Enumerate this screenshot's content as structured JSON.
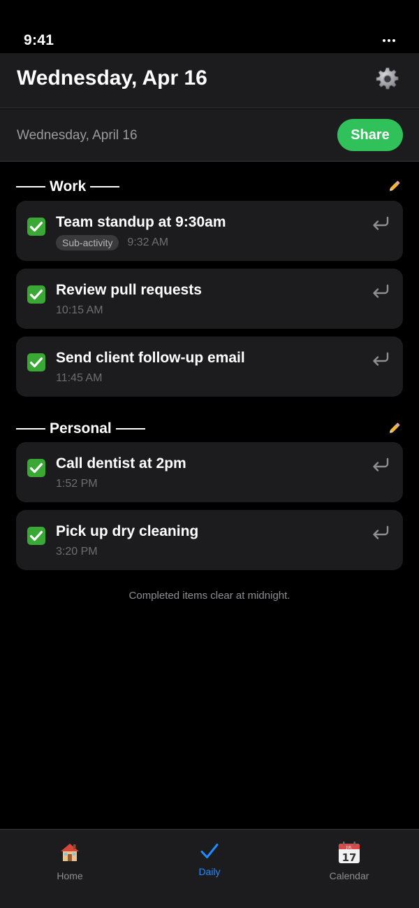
{
  "status_bar": {
    "time": "9:41"
  },
  "header": {
    "title": "Wednesday, Apr 16"
  },
  "subheader": {
    "date": "Wednesday, April 16",
    "share_label": "Share"
  },
  "sections": [
    {
      "name": "Work",
      "tasks": [
        {
          "title": "Team standup at 9:30am",
          "badge": "Sub-activity",
          "time": "9:32 AM",
          "done": true
        },
        {
          "title": "Review pull requests",
          "time": "10:15 AM",
          "done": true
        },
        {
          "title": "Send client follow-up email",
          "time": "11:45 AM",
          "done": true
        }
      ]
    },
    {
      "name": "Personal",
      "tasks": [
        {
          "title": "Call dentist at 2pm",
          "time": "1:52 PM",
          "done": true
        },
        {
          "title": "Pick up dry cleaning",
          "time": "3:20 PM",
          "done": true
        }
      ]
    }
  ],
  "footer_note": "Completed items clear at midnight.",
  "tab_bar": {
    "tabs": [
      {
        "label": "Home",
        "icon": "house-icon"
      },
      {
        "label": "Daily",
        "icon": "checkmark-icon",
        "active": true
      },
      {
        "label": "Calendar",
        "icon": "calendar-icon",
        "icon_text": "17",
        "icon_month": "JUL"
      }
    ]
  },
  "colors": {
    "accent_green": "#30c15a",
    "check_green": "#3aa835",
    "active_tab_blue": "#1f8cff",
    "card_bg": "#1c1c1e",
    "background": "#000000"
  }
}
